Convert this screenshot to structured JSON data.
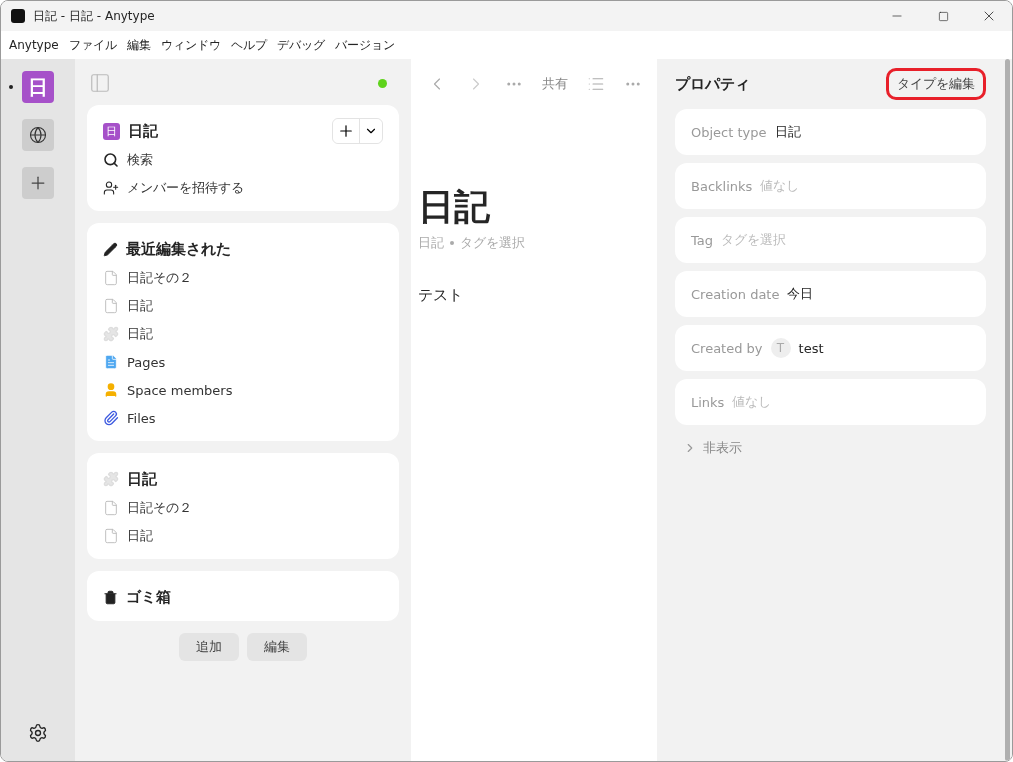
{
  "window": {
    "title": "日記 - 日記 - Anytype"
  },
  "menu": [
    "Anytype",
    "ファイル",
    "編集",
    "ウィンドウ",
    "ヘルプ",
    "デバッグ",
    "バージョン"
  ],
  "rail": [
    {
      "kind": "letter",
      "label": "日",
      "selected": true
    },
    {
      "kind": "network",
      "selected": false
    },
    {
      "kind": "add",
      "selected": false
    }
  ],
  "sidebar": {
    "online": true,
    "space": {
      "icon_letter": "日",
      "title": "日記",
      "items": [
        {
          "kind": "search",
          "label": "検索"
        },
        {
          "kind": "invite",
          "label": "メンバーを招待する"
        }
      ]
    },
    "widgets": [
      {
        "kind": "recent",
        "title": "最近編集された",
        "items": [
          {
            "kind": "page",
            "label": "日記その２"
          },
          {
            "kind": "page",
            "label": "日記"
          },
          {
            "kind": "type",
            "label": "日記"
          },
          {
            "kind": "pages",
            "label": "Pages"
          },
          {
            "kind": "members",
            "label": "Space members"
          },
          {
            "kind": "files",
            "label": "Files"
          }
        ]
      },
      {
        "kind": "type",
        "title": "日記",
        "items": [
          {
            "kind": "page",
            "label": "日記その２"
          },
          {
            "kind": "page",
            "label": "日記"
          }
        ]
      },
      {
        "kind": "bin",
        "title": "ゴミ箱"
      }
    ],
    "buttons": [
      "追加",
      "編集"
    ]
  },
  "editor": {
    "share": "共有",
    "title": "日記",
    "type": "日記",
    "tag_placeholder": "タグを選択",
    "body": "テスト"
  },
  "properties": {
    "title": "プロパティ",
    "edit_type": "タイプを編集",
    "edit_type_highlighted": true,
    "rows": [
      {
        "kind": "value",
        "label": "Object type",
        "value": "日記"
      },
      {
        "kind": "empty",
        "label": "Backlinks",
        "value": "値なし"
      },
      {
        "kind": "empty",
        "label": "Tag",
        "value": "タグを選択"
      },
      {
        "kind": "value",
        "label": "Creation date",
        "value": "今日"
      },
      {
        "kind": "user",
        "label": "Created by",
        "avatar": "T",
        "value": "test"
      },
      {
        "kind": "empty",
        "label": "Links",
        "value": "値なし"
      }
    ],
    "hidden": "非表示"
  }
}
